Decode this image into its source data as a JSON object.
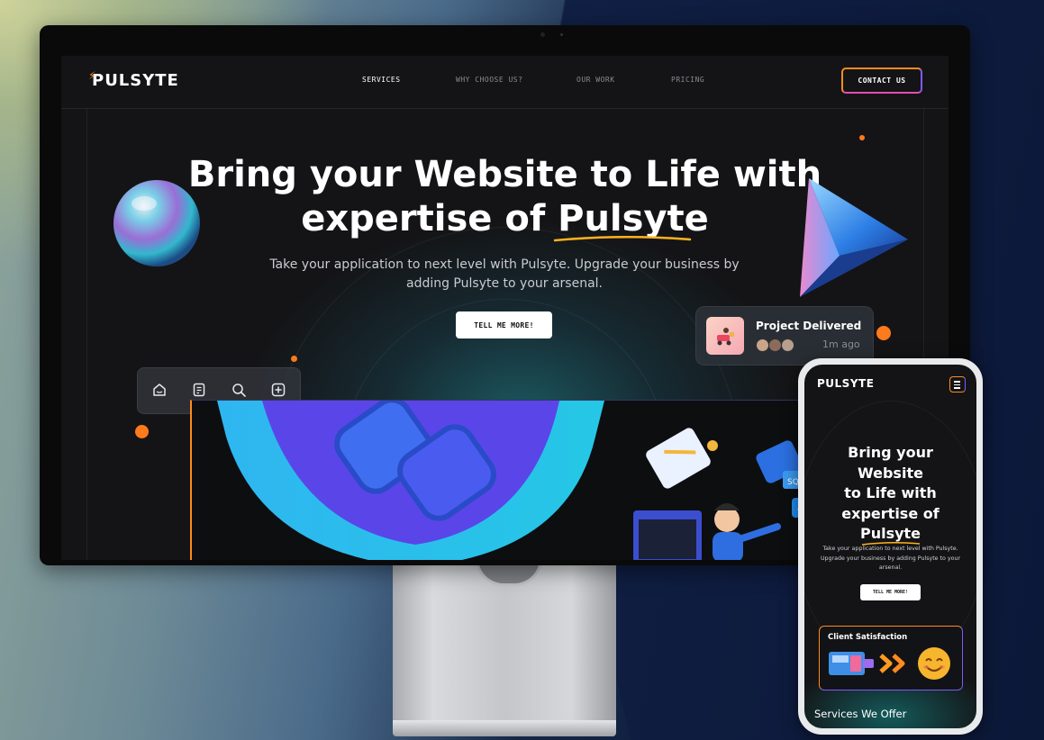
{
  "desktop": {
    "logo": "PULSYTE",
    "nav": [
      "SERVICES",
      "WHY CHOOSE US?",
      "OUR WORK",
      "PRICING"
    ],
    "contact_label": "CONTACT US",
    "hero_title_line1": "Bring your Website to Life with",
    "hero_title_line2": "expertise of Pulsyte",
    "hero_subtitle_line1": "Take your application to next level with Pulsyte. Upgrade your business by",
    "hero_subtitle_line2": "adding Pulsyte to your arsenal.",
    "cta_label": "TELL ME MORE!",
    "toolbar_icons": [
      "home-icon",
      "document-icon",
      "search-icon",
      "add-icon"
    ],
    "project_card": {
      "title": "Project Delivered",
      "time": "1m ago"
    },
    "code_badge": "{}",
    "sql_label": "SQL"
  },
  "mobile": {
    "logo": "PULSYTE",
    "hero_title_lines": [
      "Bring your",
      "Website",
      "to Life with",
      "expertise of",
      "Pulsyte"
    ],
    "hero_subtitle_lines": [
      "Take your application to next level with Pulsyte.",
      "Upgrade your business by adding Pulsyte to your",
      "arsenal."
    ],
    "cta_label": "TELL ME MORE!",
    "card_title": "Client Satisfaction",
    "section_heading": "Services We Offer"
  },
  "colors": {
    "accent_orange": "#ff8a1f",
    "accent_purple": "#7b5cff",
    "accent_teal": "#1e6e78"
  }
}
